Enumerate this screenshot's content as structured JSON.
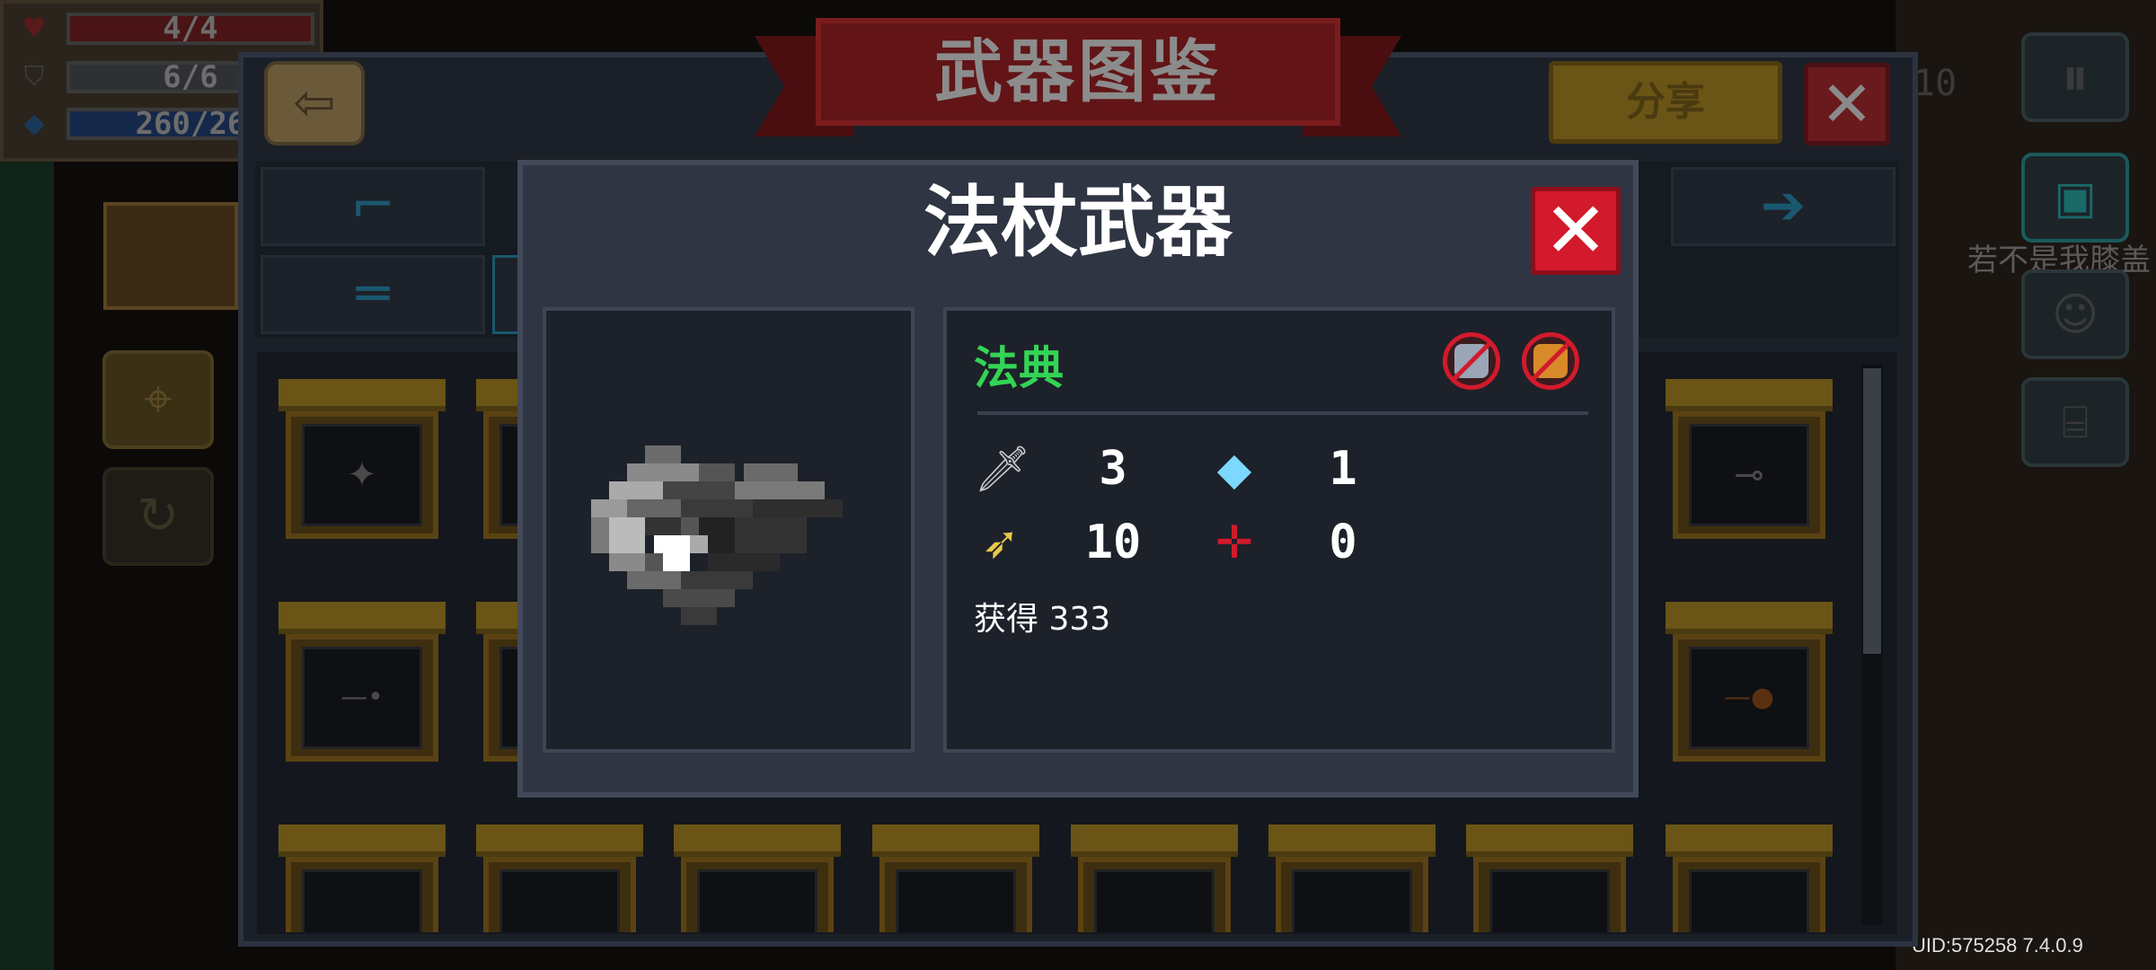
{
  "hud": {
    "health": "4/4",
    "armor": "6/6",
    "energy": "260/26",
    "health_icon": "heart-icon",
    "armor_icon": "shield-icon",
    "energy_icon": "diamond-icon"
  },
  "window": {
    "title": "武器图鉴",
    "share_label": "分享",
    "close_symbol": "✕",
    "back_symbol": "⇦"
  },
  "right_hud": {
    "partial_number": "10",
    "partial_text": "若不是我膝盖"
  },
  "popup": {
    "title": "法杖武器",
    "close_symbol": "✕",
    "weapon_name": "法典",
    "stats": {
      "damage": "3",
      "energy_cost": "1",
      "crit": "10",
      "spread": "0"
    },
    "obtain_text": "获得 333"
  },
  "uid_text": "UID:575258 7.4.0.9",
  "colors": {
    "weapon_name": "#33d455",
    "close_red": "#d21a2c",
    "popup_bg": "#2f3542"
  }
}
